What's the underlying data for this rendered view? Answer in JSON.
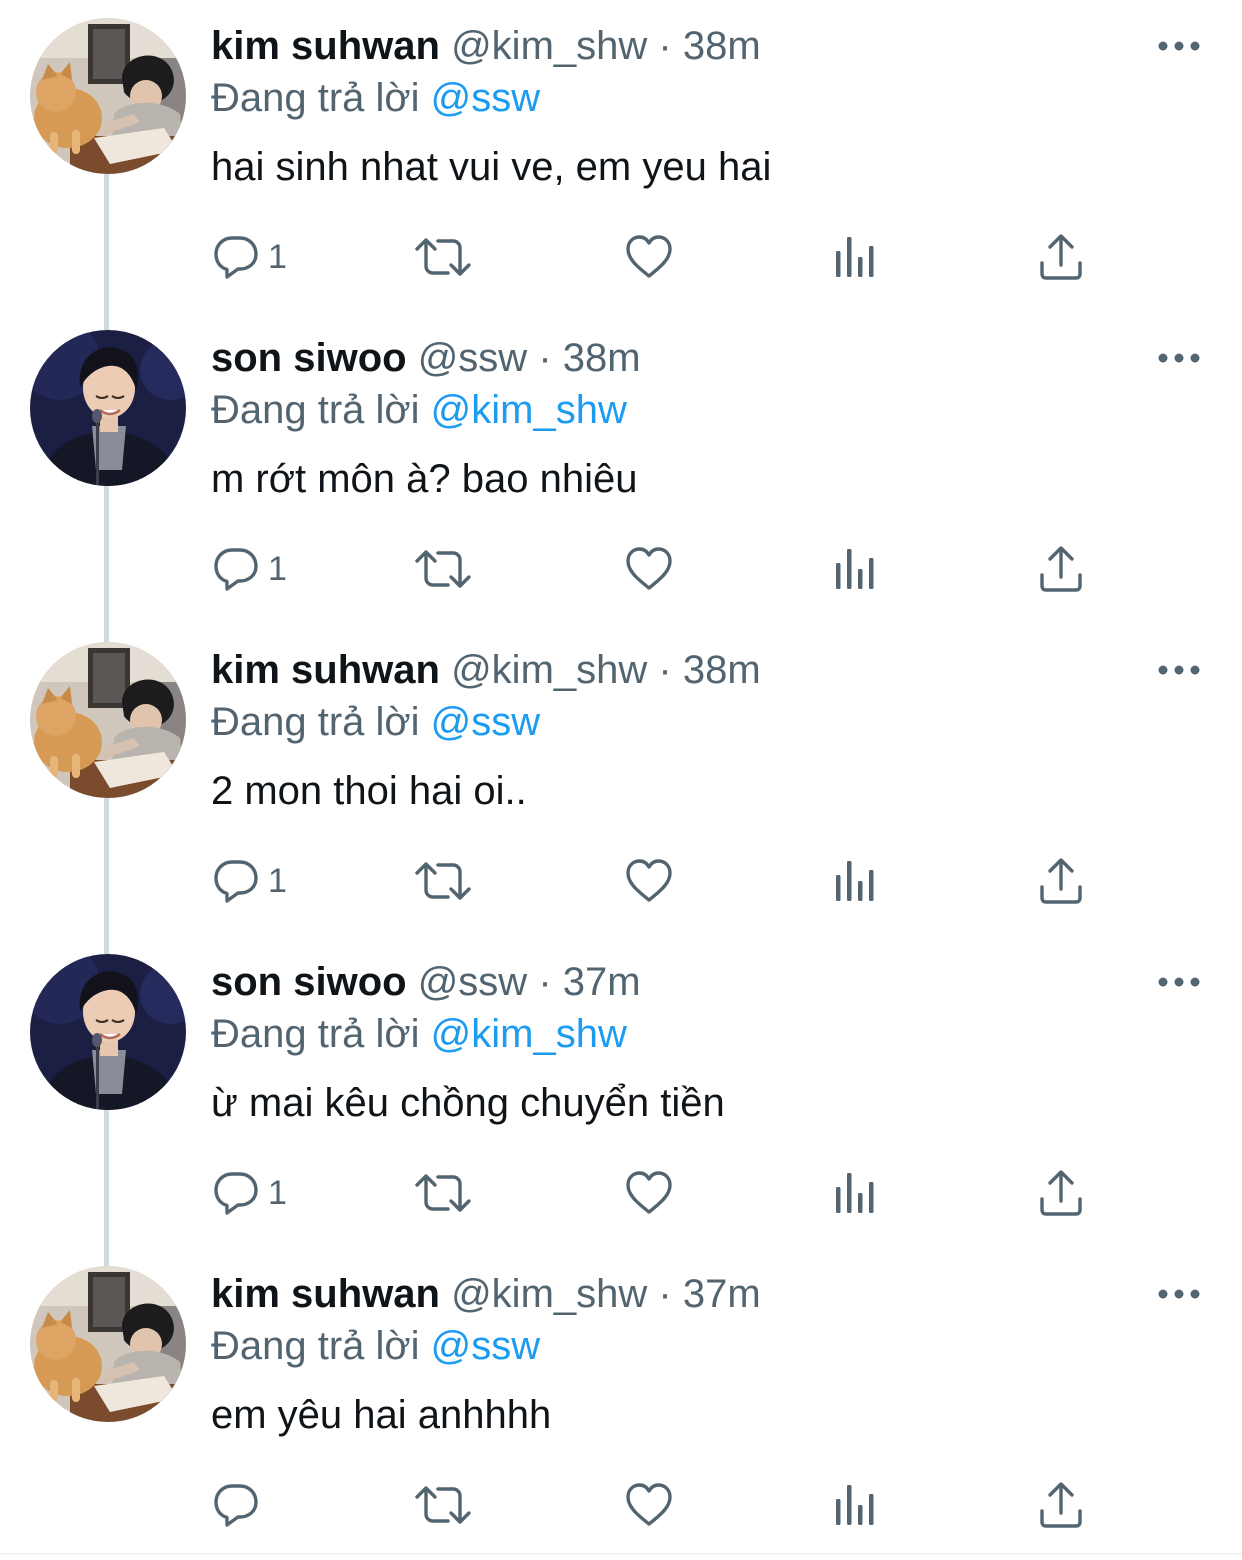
{
  "tweets": [
    {
      "name": "kim suhwan",
      "handle": "@kim_shw",
      "dot": "·",
      "time": "38m",
      "reply_prefix": "Đang trả lời",
      "reply_to": "@ssw",
      "text": "hai sinh nhat vui ve, em yeu hai",
      "reply_count": "1",
      "avatar": "cat-desk"
    },
    {
      "name": "son siwoo",
      "handle": "@ssw",
      "dot": "·",
      "time": "38m",
      "reply_prefix": "Đang trả lời",
      "reply_to": "@kim_shw",
      "text": "m rớt môn à? bao nhiêu",
      "reply_count": "1",
      "avatar": "man-mic"
    },
    {
      "name": "kim suhwan",
      "handle": "@kim_shw",
      "dot": "·",
      "time": "38m",
      "reply_prefix": "Đang trả lời",
      "reply_to": "@ssw",
      "text": "2 mon thoi hai oi..",
      "reply_count": "1",
      "avatar": "cat-desk"
    },
    {
      "name": "son siwoo",
      "handle": "@ssw",
      "dot": "·",
      "time": "37m",
      "reply_prefix": "Đang trả lời",
      "reply_to": "@kim_shw",
      "text": "ừ mai kêu chồng chuyển tiền",
      "reply_count": "1",
      "avatar": "man-mic"
    },
    {
      "name": "kim suhwan",
      "handle": "@kim_shw",
      "dot": "·",
      "time": "37m",
      "reply_prefix": "Đang trả lời",
      "reply_to": "@ssw",
      "text": "em yêu hai anhhhh",
      "reply_count": "",
      "avatar": "cat-desk"
    }
  ],
  "icons": {
    "reply": "reply-icon",
    "retweet": "retweet-icon",
    "like": "heart-icon",
    "views": "analytics-icon",
    "share": "share-icon",
    "more": "more-icon"
  },
  "colors": {
    "text": "#0f1419",
    "secondary": "#536471",
    "link": "#1d9bf0",
    "thread_line": "#cfd9de"
  }
}
